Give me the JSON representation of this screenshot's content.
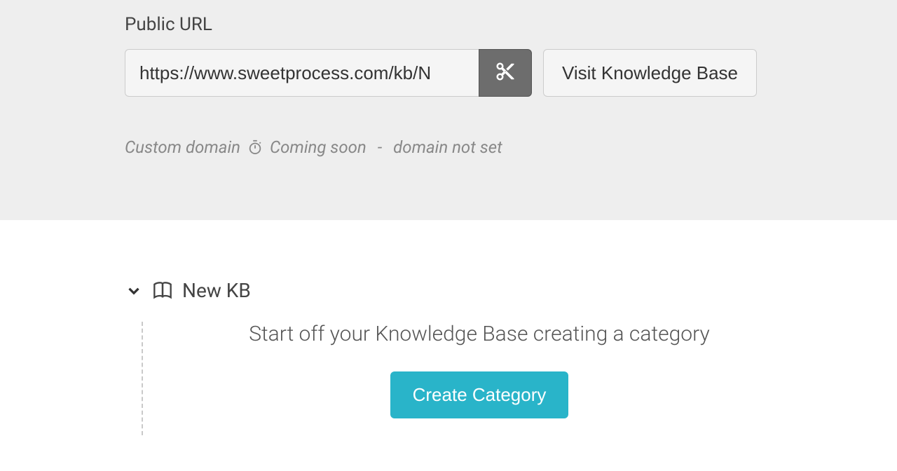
{
  "public_url": {
    "label": "Public URL",
    "value": "https://www.sweetprocess.com/kb/N",
    "visit_label": "Visit Knowledge Base"
  },
  "custom_domain": {
    "label": "Custom domain",
    "coming_soon": "Coming soon",
    "separator": "-",
    "not_set": "domain not set"
  },
  "kb": {
    "title": "New KB",
    "prompt": "Start off your Knowledge Base creating a category",
    "create_button": "Create Category"
  }
}
